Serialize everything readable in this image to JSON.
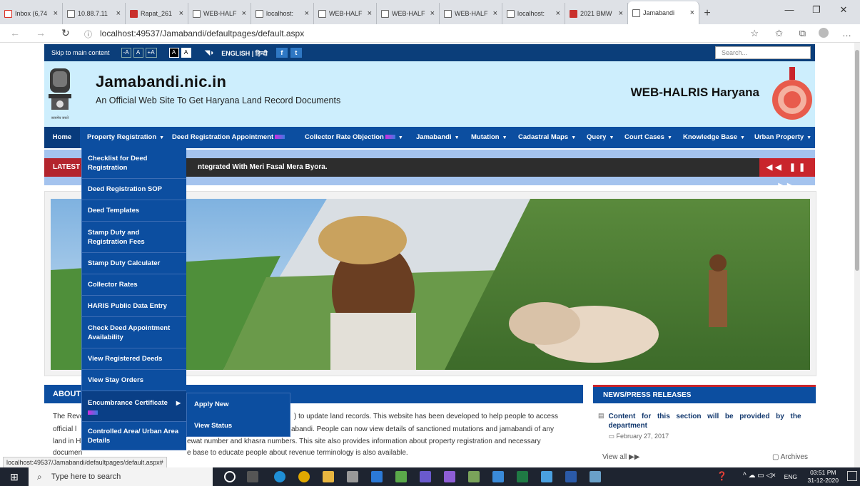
{
  "browser": {
    "tabs": [
      {
        "label": "Inbox (6,74",
        "icon": "gmail-icon"
      },
      {
        "label": "10.88.7.11",
        "icon": "page-icon"
      },
      {
        "label": "Rapat_261",
        "icon": "pdf-icon"
      },
      {
        "label": "WEB-HALF",
        "icon": "page-icon"
      },
      {
        "label": "localhost:",
        "icon": "page-icon"
      },
      {
        "label": "WEB-HALF",
        "icon": "page-icon"
      },
      {
        "label": "WEB-HALF",
        "icon": "page-icon"
      },
      {
        "label": "WEB-HALF",
        "icon": "page-icon"
      },
      {
        "label": "localhost:",
        "icon": "page-icon"
      },
      {
        "label": "2021 BMW",
        "icon": "bmw-icon"
      },
      {
        "label": "Jamabandi",
        "icon": "page-icon",
        "active": true
      }
    ],
    "url": "localhost:49537/Jamabandi/defaultpages/default.aspx",
    "status_url": "localhost:49537/Jamabandi/defaultpages/default.aspx#"
  },
  "utility": {
    "skip": "Skip to main content",
    "font_buttons": [
      "-A",
      "A",
      "+A"
    ],
    "contrast_buttons": [
      "A",
      "A"
    ],
    "lang": "ENGLISH | हिन्दी",
    "search_placeholder": "Search..."
  },
  "header": {
    "title": "Jamabandi.nic.in",
    "subtitle": "An Official Web Site To Get Haryana Land Record Documents",
    "right_title": "WEB-HALRIS Haryana",
    "emblem_caption": "सत्यमेव जयते"
  },
  "nav": {
    "items": [
      {
        "label": "Home"
      },
      {
        "label": "Property Registration",
        "caret": "▼"
      },
      {
        "label": "Deed Registration Appointment",
        "new": true
      },
      {
        "label": "Collector Rate Objection",
        "new": true,
        "caret": "▼"
      },
      {
        "label": "Jamabandi",
        "caret": "▼"
      },
      {
        "label": "Mutation",
        "caret": "▼"
      },
      {
        "label": "Cadastral Maps",
        "caret": "▼"
      },
      {
        "label": "Query",
        "caret": "▼"
      },
      {
        "label": "Court Cases",
        "caret": "▼"
      },
      {
        "label": "Knowledge Base",
        "caret": "▼"
      },
      {
        "label": "Urban Property",
        "caret": "▼"
      }
    ]
  },
  "ticker": {
    "label": "LATEST",
    "text": "ntegrated With Meri Fasal Mera Byora.",
    "controls": "◀◀ ❚❚ ▶▶"
  },
  "dropdown": {
    "items": [
      {
        "label": "Checklist for Deed Registration"
      },
      {
        "label": "Deed Registration SOP"
      },
      {
        "label": "Deed Templates"
      },
      {
        "label": "Stamp Duty and Registration Fees"
      },
      {
        "label": "Stamp Duty Calculater"
      },
      {
        "label": "Collector Rates"
      },
      {
        "label": "HARIS Public Data Entry"
      },
      {
        "label": "Check Deed Appointment Availability"
      },
      {
        "label": "View Registered Deeds"
      },
      {
        "label": "View Stay Orders"
      },
      {
        "label": "Encumbrance Certificate",
        "new": true,
        "arrow": "▶"
      },
      {
        "label": "Controlled Area/ Urban Area Details"
      }
    ],
    "submenu": [
      "Apply New",
      "View Status"
    ]
  },
  "about": {
    "title": "ABOUT",
    "lines": [
      {
        "left": "The Reve",
        "right": ") to update land records. This website has been developed to help people to access"
      },
      {
        "left": "official l",
        "right": "abandi. People can now view details of sanctioned mutations and jamabandi of any"
      },
      {
        "left": "land in H",
        "right": "ewat number and khasra numbers. This site also provides information about property registration and necessary"
      },
      {
        "left": "documen",
        "right": "e base to educate people about revenue terminology is also available."
      }
    ]
  },
  "news": {
    "title": "NEWS/PRESS RELEASES",
    "item_text": "Content for this section will be provided by the department",
    "item_date": "February 27, 2017",
    "view_all": "View all",
    "archives": "Archives"
  },
  "taskbar": {
    "search_placeholder": "Type here to search",
    "lang": "ENG",
    "time": "03:51 PM",
    "date": "31-12-2020"
  },
  "colors": {
    "nav_blue": "#0c4ea0",
    "header_bg": "#cdeefd",
    "accent_red": "#c9252c",
    "utility_blue": "#0b3e7a"
  }
}
